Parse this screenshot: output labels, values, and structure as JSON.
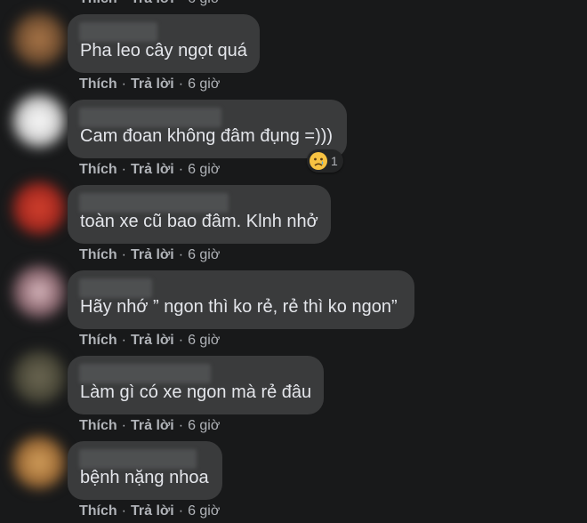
{
  "actions": {
    "like_label": "Thích",
    "reply_label": "Trả lời",
    "separator": "·",
    "time": "6 giờ"
  },
  "comments": [
    {
      "text": "Pha leo cây ngọt quá"
    },
    {
      "text": "Cam đoan không đâm đụng =)))",
      "reaction": {
        "icon": "sad-face-icon",
        "count": "1"
      }
    },
    {
      "text": "toàn xe cũ bao đâm. Klnh nhở"
    },
    {
      "text": "Hãy nhớ ” ngon thì ko rẻ, rẻ thì ko ngon”"
    },
    {
      "text": "Làm gì có xe ngon mà rẻ đâu"
    },
    {
      "text": "bệnh nặng nhoa"
    }
  ],
  "colors": {
    "background": "#18191a",
    "bubble": "#3a3b3c",
    "text": "#e4e6eb",
    "meta_text": "#b0b3b8"
  }
}
